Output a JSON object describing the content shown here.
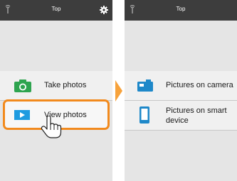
{
  "left_screen": {
    "title": "Top",
    "items": [
      {
        "label": "Take photos",
        "icon": "camera-icon",
        "color": "#2ea44f"
      },
      {
        "label": "View photos",
        "icon": "play-icon",
        "color": "#1e9be0"
      }
    ],
    "highlight_color": "#f28a1d"
  },
  "right_screen": {
    "title": "Top",
    "items": [
      {
        "label": "Pictures on camera",
        "icon": "camera-icon",
        "color": "#1e88c9"
      },
      {
        "label": "Pictures on smart device",
        "icon": "smartphone-icon",
        "color": "#1e88c9"
      }
    ]
  },
  "colors": {
    "topbar": "#3d3d3d",
    "background": "#e5e5e5",
    "accent_arrow": "#f7a23b"
  }
}
